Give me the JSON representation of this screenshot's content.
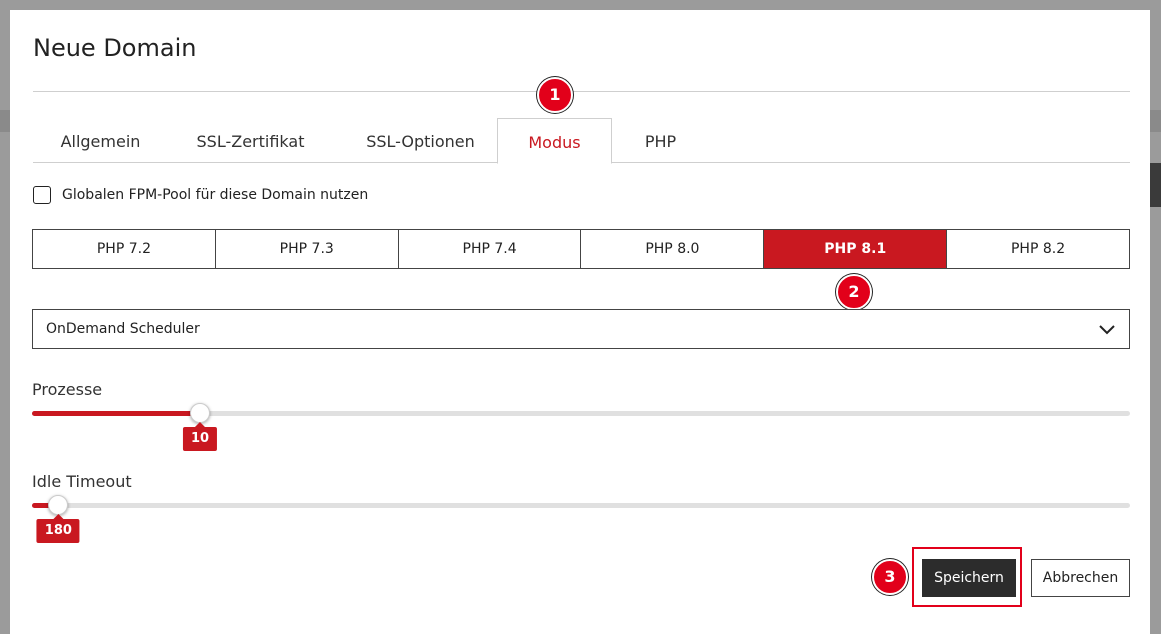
{
  "dialog": {
    "title": "Neue Domain"
  },
  "tabs": [
    {
      "label": "Allgemein",
      "active": false
    },
    {
      "label": "SSL-Zertifikat",
      "active": false
    },
    {
      "label": "SSL-Optionen",
      "active": false
    },
    {
      "label": "Modus",
      "active": true
    },
    {
      "label": "PHP",
      "active": false
    }
  ],
  "fpm_pool": {
    "label": "Globalen FPM-Pool für diese Domain nutzen",
    "checked": false
  },
  "php_versions": [
    {
      "label": "PHP 7.2",
      "active": false
    },
    {
      "label": "PHP 7.3",
      "active": false
    },
    {
      "label": "PHP 7.4",
      "active": false
    },
    {
      "label": "PHP 8.0",
      "active": false
    },
    {
      "label": "PHP 8.1",
      "active": true
    },
    {
      "label": "PHP 8.2",
      "active": false
    }
  ],
  "scheduler": {
    "selected": "OnDemand Scheduler"
  },
  "sliders": {
    "prozesse": {
      "label": "Prozesse",
      "value": "10",
      "fill_percent": 15.3
    },
    "idle_timeout": {
      "label": "Idle Timeout",
      "value": "180",
      "fill_percent": 2.4
    }
  },
  "buttons": {
    "save": "Speichern",
    "cancel": "Abbrechen"
  },
  "annotations": [
    "1",
    "2",
    "3"
  ],
  "colors": {
    "accent": "#c91820",
    "marker": "#e2001a",
    "primary_button": "#2c2c2c"
  }
}
